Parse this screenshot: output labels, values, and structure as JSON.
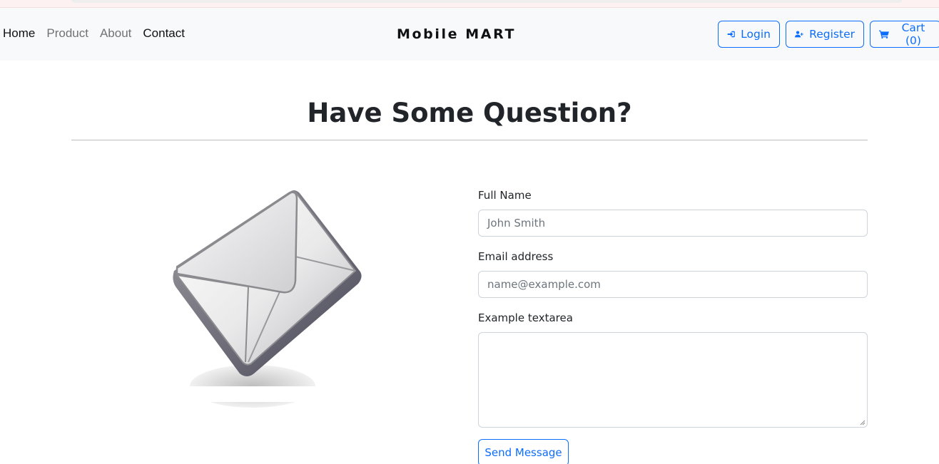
{
  "nav": {
    "links": [
      {
        "label": "Home",
        "active": true
      },
      {
        "label": "Product",
        "active": false
      },
      {
        "label": "About",
        "active": false
      },
      {
        "label": "Contact",
        "active": true
      }
    ],
    "brand": "Mobile MART",
    "buttons": {
      "login": {
        "label": "Login",
        "icon": "sign-in-icon"
      },
      "register": {
        "label": "Register",
        "icon": "user-plus-icon"
      },
      "cart": {
        "label": "Cart (0)",
        "icon": "cart-icon"
      }
    }
  },
  "main": {
    "title": "Have Some Question?",
    "image": {
      "icon": "envelope-icon"
    },
    "form": {
      "full_name": {
        "label": "Full Name",
        "placeholder": "John Smith",
        "value": ""
      },
      "email": {
        "label": "Email address",
        "placeholder": "name@example.com",
        "value": ""
      },
      "message": {
        "label": "Example textarea",
        "value": ""
      },
      "submit_label": "Send Message"
    }
  },
  "colors": {
    "accent": "#0d6efd",
    "navbar_bg": "#f8f9fa",
    "text": "#212529"
  }
}
